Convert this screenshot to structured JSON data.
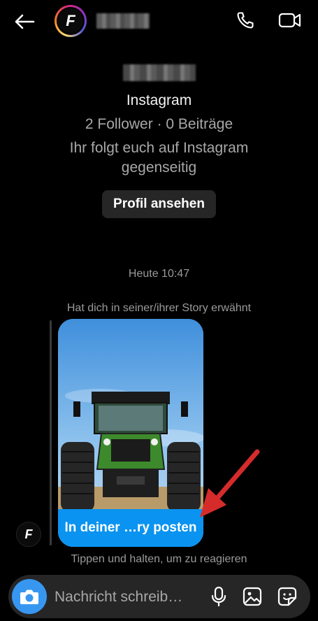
{
  "header": {
    "back_icon": "arrow-left-icon",
    "avatar_letter": "F",
    "call_icon": "phone-icon",
    "video_icon": "video-camera-icon"
  },
  "profile": {
    "platform": "Instagram",
    "stats": "2 Follower · 0 Beiträge",
    "mutual": "Ihr folgt euch auf Instagram gegenseitig",
    "view_profile_label": "Profil ansehen"
  },
  "thread": {
    "timestamp": "Heute 10:47",
    "mention_text": "Hat dich in seiner/ihrer Story erwähnt",
    "story_cta": "In deiner …ry posten",
    "hint": "Tippen und halten, um zu reagieren"
  },
  "composer": {
    "placeholder": "Nachricht schreib…",
    "camera_icon": "camera-icon",
    "mic_icon": "microphone-icon",
    "gallery_icon": "image-icon",
    "sticker_icon": "sticker-icon"
  },
  "colors": {
    "accent": "#3797f0",
    "cta": "#0a93f0",
    "annotation": "#d62b2b"
  }
}
